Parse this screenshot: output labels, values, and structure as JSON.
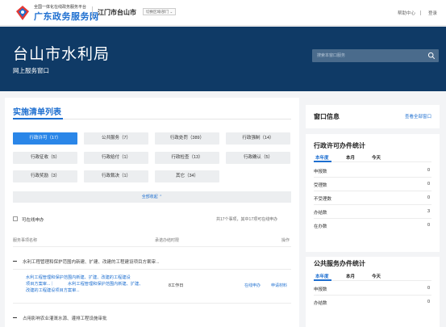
{
  "header": {
    "brand_sub": "全国一体化在线政务服务平台",
    "brand_main": "广东政务服务网",
    "city": "江门市台山市",
    "switch_label": "切换区域/部门 ⌄",
    "help": "帮助中心",
    "login": "登录"
  },
  "banner": {
    "title": "台山市水利局",
    "subtitle": "网上服务窗口",
    "search_placeholder": "搜索本窗口服务"
  },
  "main": {
    "section_title": "实施清单列表",
    "categories": [
      {
        "label": "行政许可（17）",
        "active": true
      },
      {
        "label": "公共服务（7）",
        "active": false
      },
      {
        "label": "行政处罚（389）",
        "active": false
      },
      {
        "label": "行政强制（14）",
        "active": false
      },
      {
        "label": "行政征收（5）",
        "active": false
      },
      {
        "label": "行政给付（1）",
        "active": false
      },
      {
        "label": "行政检查（13）",
        "active": false
      },
      {
        "label": "行政确认（5）",
        "active": false
      },
      {
        "label": "行政奖励（3）",
        "active": false
      },
      {
        "label": "行政裁决（1）",
        "active": false
      },
      {
        "label": "其它（34）",
        "active": false
      }
    ],
    "collapse_label": "全部收起 ⌃",
    "filter_label": "可在线申办",
    "count_text": "共17个事项，其中17项可在线申办",
    "columns": {
      "name": "服务事项名称",
      "time": "承诺办结时限",
      "action": "操作"
    },
    "rows": [
      {
        "title": "水利工程管理和保护范围内新建、扩建、改建的工程建设项目方案审...",
        "sub_link_lines": [
          "水利工程管理和保护范围内新建、扩建、改建的工程建设",
          "项目方案审...｜"
        ],
        "sub_plain_lines": [
          "水利工程管理和保护范围内新建、扩建、",
          "改建的工程建设项目方案审..."
        ],
        "time": "8工作日",
        "action_online": "在线申办",
        "action_guide": "申请材料"
      },
      {
        "title": "占用影响农业灌溉水源、灌排工程设施审批"
      }
    ]
  },
  "window_info": {
    "title": "窗口信息",
    "link": "查看全部窗口"
  },
  "permit_stats": {
    "title": "行政许可办件统计",
    "tabs": [
      "本年度",
      "本月",
      "今天"
    ],
    "items": [
      {
        "label": "申报数",
        "value": "0"
      },
      {
        "label": "受理数",
        "value": "0"
      },
      {
        "label": "不受理数",
        "value": "0"
      },
      {
        "label": "办结数",
        "value": "3"
      },
      {
        "label": "在办数",
        "value": "0"
      }
    ]
  },
  "public_stats": {
    "title": "公共服务办件统计",
    "tabs": [
      "本年度",
      "本月",
      "今天"
    ],
    "items": [
      {
        "label": "申报数",
        "value": "0"
      },
      {
        "label": "办结数",
        "value": "0"
      }
    ]
  },
  "colors": {
    "accent": "#1e6fd0",
    "banner": "#0f3a66",
    "active_tab": "#2a86e8"
  }
}
